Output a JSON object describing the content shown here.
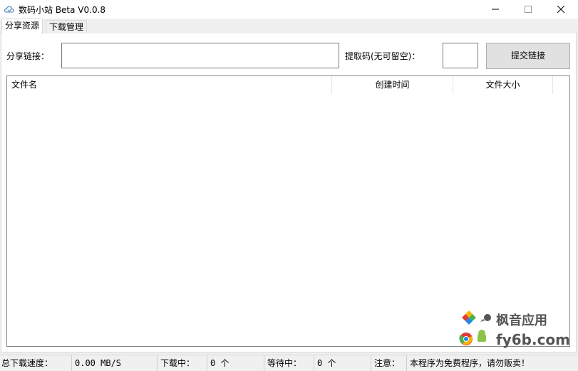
{
  "window": {
    "title": "数码小站 Beta V0.0.8",
    "icon": "cloud-icon"
  },
  "tabs": [
    {
      "label": "分享资源",
      "active": true
    },
    {
      "label": "下载管理",
      "active": false
    }
  ],
  "form": {
    "share_label": "分享链接：",
    "share_value": "",
    "code_label": "提取码(无可留空)：",
    "code_value": "",
    "submit_label": "提交链接"
  },
  "file_list": {
    "columns": [
      "文件名",
      "创建时间",
      "文件大小"
    ],
    "rows": []
  },
  "status": {
    "total_speed_label": "总下载速度：",
    "total_speed_value": "0.00 MB/S",
    "downloading_label": "下载中：",
    "downloading_value": "0 个",
    "waiting_label": "等待中：",
    "waiting_value": "0 个",
    "notice_label": "注意：",
    "notice_text": "本程序为免费程序，请勿贩卖！"
  },
  "watermark": {
    "line1": "枫音应用",
    "line2": "fy6b.com"
  }
}
